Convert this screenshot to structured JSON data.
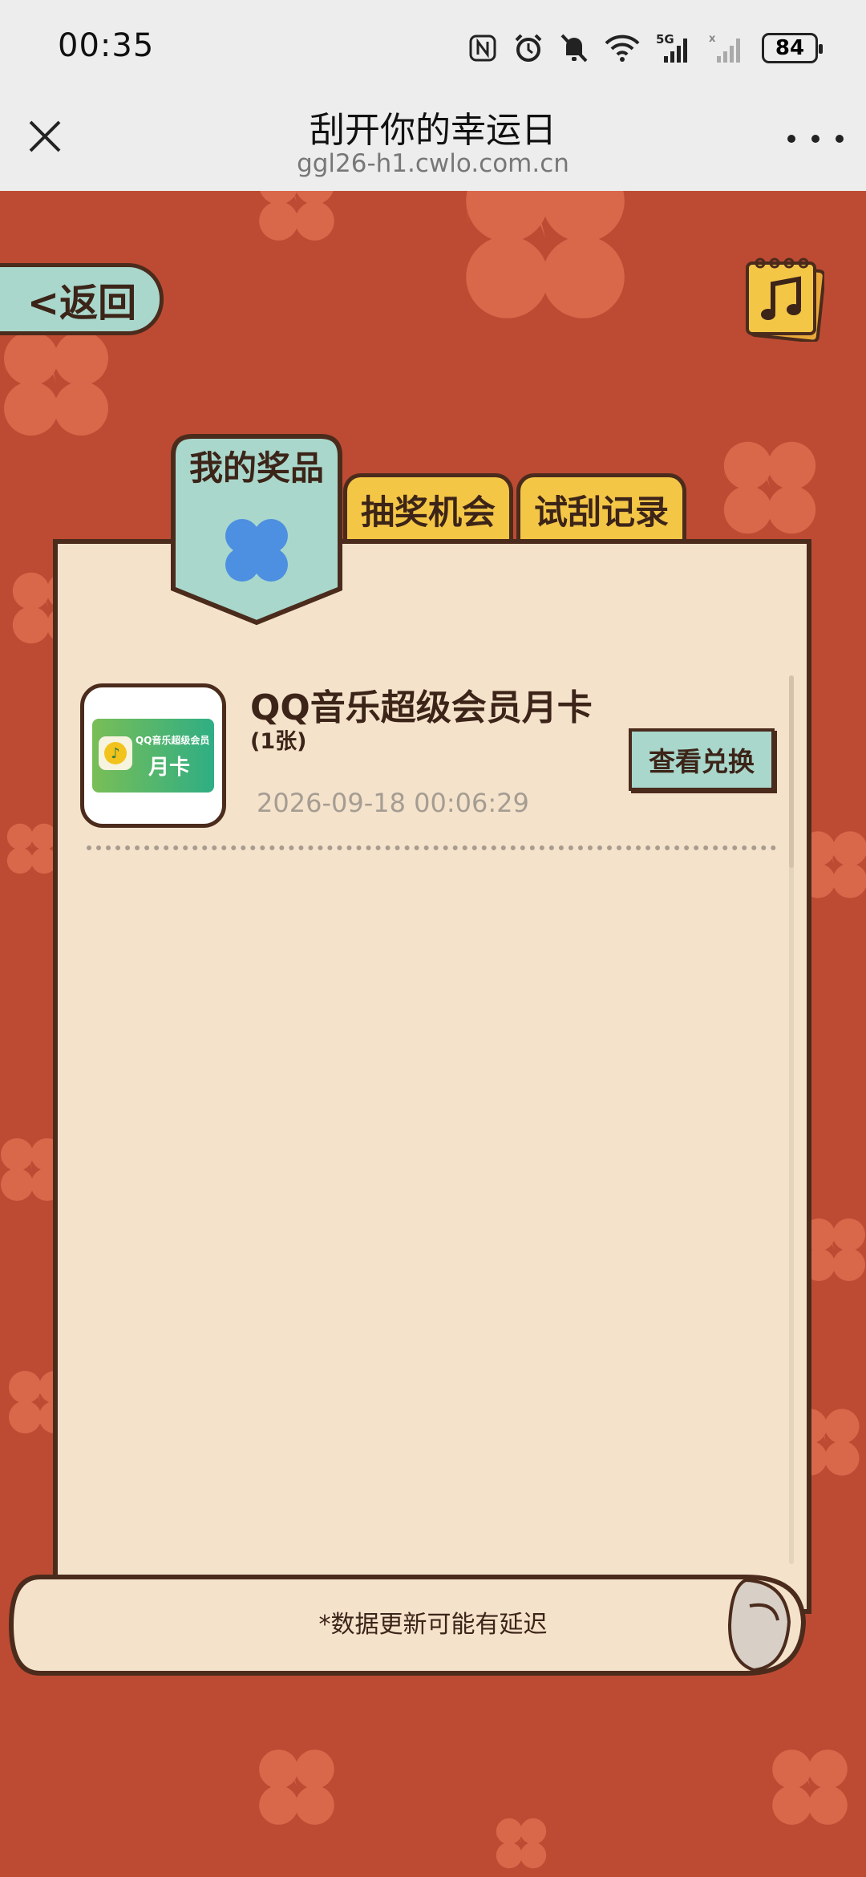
{
  "status_bar": {
    "time": "00:35",
    "battery": "84",
    "icons": [
      "nfc-icon",
      "alarm-icon",
      "mute-icon",
      "wifi-icon",
      "signal-5g-icon",
      "signal-icon",
      "battery-icon"
    ]
  },
  "title_bar": {
    "title": "刮开你的幸运日",
    "url": "ggl26-h1.cwlo.com.cn"
  },
  "nav": {
    "back_label": "<返回"
  },
  "tabs": [
    {
      "label": "我的奖品",
      "active": true
    },
    {
      "label": "抽奖机会",
      "active": false
    },
    {
      "label": "试刮记录",
      "active": false
    }
  ],
  "prizes": [
    {
      "name": "QQ音乐超级会员月卡",
      "count": "(1张)",
      "date": "2026-09-18 00:06:29",
      "action": "查看兑换",
      "card_line1": "QQ音乐超级会员",
      "card_line2": "月卡"
    }
  ],
  "footer": {
    "note": "*数据更新可能有延迟"
  },
  "colors": {
    "background": "#bd4b33",
    "panel": "#f4e2cb",
    "tab_yellow": "#f4c646",
    "teal": "#a9d7cc",
    "outline": "#4b2b1c",
    "clover_blue": "#4d8fe0",
    "clover_bg": "#d9674a"
  }
}
